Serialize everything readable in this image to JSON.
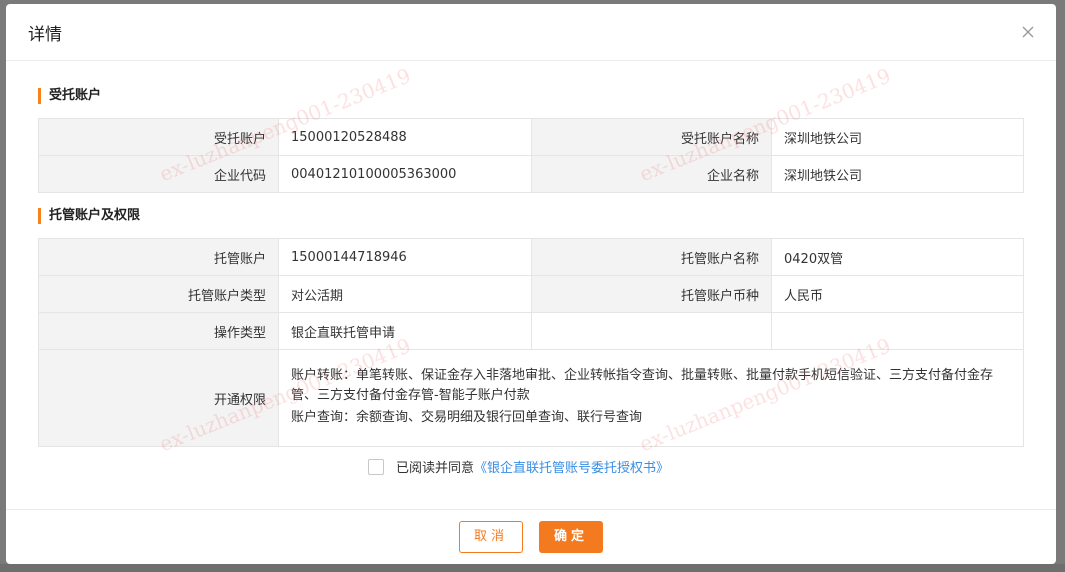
{
  "dialog": {
    "title": "详情",
    "close_icon": "close-icon"
  },
  "trust_section": {
    "title": "受托账户",
    "rows": [
      {
        "label1": "受托账户",
        "value1": "15000120528488",
        "label2": "受托账户名称",
        "value2": "深圳地铁公司"
      },
      {
        "label1": "企业代码",
        "value1": "00401210100005363000",
        "label2": "企业名称",
        "value2": "深圳地铁公司"
      }
    ]
  },
  "custody_section": {
    "title": "托管账户及权限",
    "rows": [
      {
        "label1": "托管账户",
        "value1": "15000144718946",
        "label2": "托管账户名称",
        "value2": "0420双管"
      },
      {
        "label1": "托管账户类型",
        "value1": "对公活期",
        "label2": "托管账户币种",
        "value2": "人民币"
      },
      {
        "label1": "操作类型",
        "value1": "银企直联托管申请",
        "label2": "",
        "value2": ""
      }
    ],
    "permission": {
      "label": "开通权限",
      "transfer": "账户转账：单笔转账、保证金存入非落地审批、企业转帐指令查询、批量转账、批量付款手机短信验证、三方支付备付金存管、三方支付备付金存管-智能子账户付款",
      "query": "账户查询：余额查询、交易明细及银行回单查询、联行号查询"
    }
  },
  "agreement": {
    "prefix": "已阅读并同意",
    "link": "《银企直联托管账号委托授权书》",
    "checked": false
  },
  "footer": {
    "cancel_label": "取消",
    "confirm_label": "确定"
  },
  "watermark": {
    "text": "ex-luzhanpeng001-230419"
  },
  "colors": {
    "accent": "#f47a1f",
    "link": "#3a8ee6",
    "label_bg": "#f3f3f3"
  }
}
